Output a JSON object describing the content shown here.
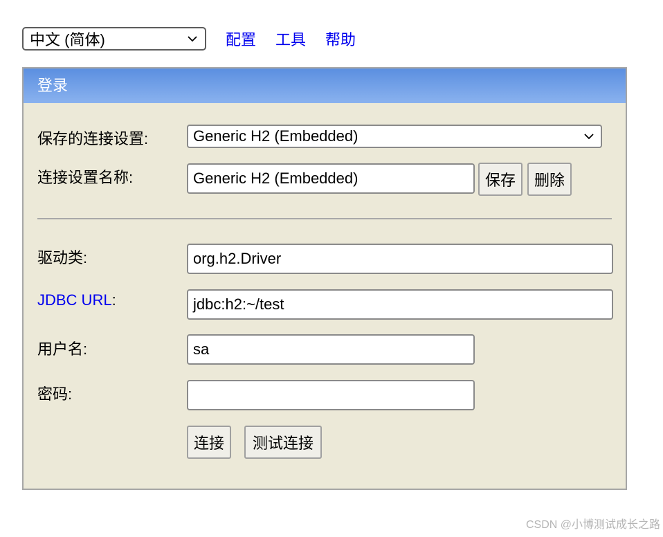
{
  "topbar": {
    "language_select": "中文 (简体)",
    "links": [
      "配置",
      "工具",
      "帮助"
    ]
  },
  "panel": {
    "title": "登录",
    "saved_settings_label": "保存的连接设置:",
    "saved_settings_value": "Generic H2 (Embedded)",
    "setting_name_label": "连接设置名称:",
    "setting_name_value": "Generic H2 (Embedded)",
    "save_button": "保存",
    "delete_button": "删除",
    "driver_label": "驱动类:",
    "driver_value": "org.h2.Driver",
    "jdbc_link": "JDBC URL",
    "jdbc_colon": ":",
    "jdbc_value": "jdbc:h2:~/test",
    "user_label": "用户名:",
    "user_value": "sa",
    "password_label": "密码:",
    "password_value": "",
    "connect_button": "连接",
    "test_button": "测试连接"
  },
  "watermark": "CSDN @小博测试成长之路",
  "colors": {
    "header_gradient_top": "#5b8fe0",
    "header_gradient_bottom": "#8ab2ef",
    "panel_bg": "#ece9d8",
    "link": "#0000ee"
  }
}
